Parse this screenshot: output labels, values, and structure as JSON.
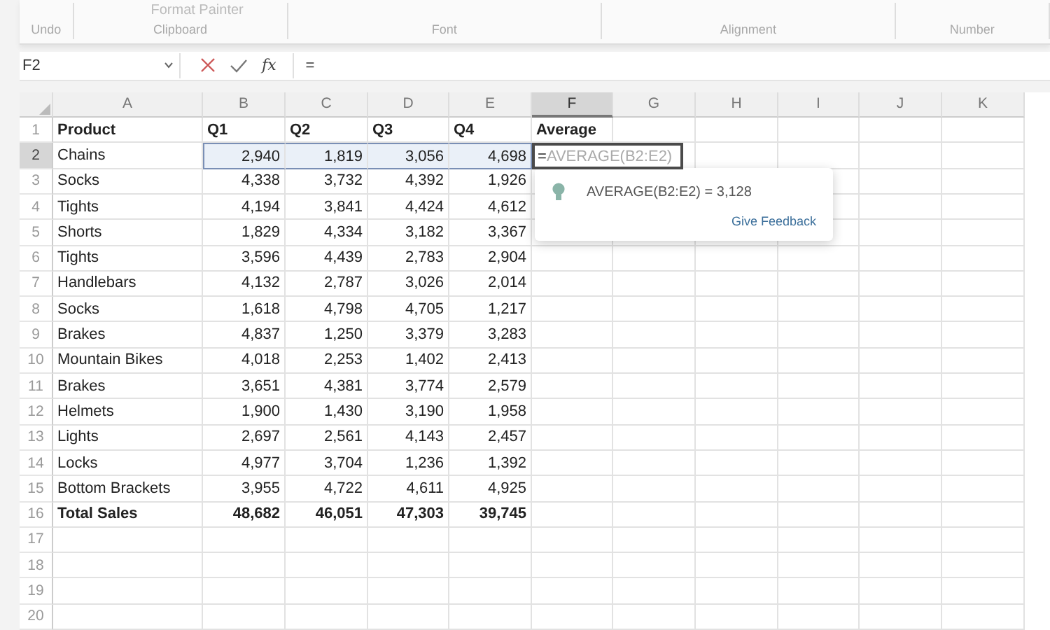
{
  "ribbon": {
    "groups": [
      {
        "label": "Undo"
      },
      {
        "label": "Clipboard",
        "command": "Format Painter"
      },
      {
        "label": "Font"
      },
      {
        "label": "Alignment"
      },
      {
        "label": "Number"
      }
    ]
  },
  "formula_bar": {
    "name_box": "F2",
    "function_label": "fx",
    "value": "="
  },
  "sheet": {
    "columns": [
      {
        "label": "A",
        "selected": false
      },
      {
        "label": "B",
        "selected": false
      },
      {
        "label": "C",
        "selected": false
      },
      {
        "label": "D",
        "selected": false
      },
      {
        "label": "E",
        "selected": false
      },
      {
        "label": "F",
        "selected": true
      },
      {
        "label": "G",
        "selected": false
      },
      {
        "label": "H",
        "selected": false
      },
      {
        "label": "I",
        "selected": false
      },
      {
        "label": "J",
        "selected": false
      },
      {
        "label": "K",
        "selected": false
      }
    ],
    "rows": [
      {
        "number": "1",
        "kind": "header",
        "selected": false,
        "highlighted": false,
        "cells": [
          "Product",
          "Q1",
          "Q2",
          "Q3",
          "Q4",
          "Average"
        ]
      },
      {
        "number": "2",
        "kind": "data",
        "selected": true,
        "highlighted": true,
        "cells": [
          "Chains",
          "2,940",
          "1,819",
          "3,056",
          "4,698"
        ],
        "editing": {
          "typed": "=",
          "suggestion": "AVERAGE(B2:E2)"
        }
      },
      {
        "number": "3",
        "kind": "data",
        "selected": false,
        "highlighted": false,
        "cells": [
          "Socks",
          "4,338",
          "3,732",
          "4,392",
          "1,926"
        ]
      },
      {
        "number": "4",
        "kind": "data",
        "selected": false,
        "highlighted": false,
        "cells": [
          "Tights",
          "4,194",
          "3,841",
          "4,424",
          "4,612"
        ]
      },
      {
        "number": "5",
        "kind": "data",
        "selected": false,
        "highlighted": false,
        "cells": [
          "Shorts",
          "1,829",
          "4,334",
          "3,182",
          "3,367"
        ]
      },
      {
        "number": "6",
        "kind": "data",
        "selected": false,
        "highlighted": false,
        "cells": [
          "Tights",
          "3,596",
          "4,439",
          "2,783",
          "2,904"
        ]
      },
      {
        "number": "7",
        "kind": "data",
        "selected": false,
        "highlighted": false,
        "cells": [
          "Handlebars",
          "4,132",
          "2,787",
          "3,026",
          "2,014"
        ]
      },
      {
        "number": "8",
        "kind": "data",
        "selected": false,
        "highlighted": false,
        "cells": [
          "Socks",
          "1,618",
          "4,798",
          "4,705",
          "1,217"
        ]
      },
      {
        "number": "9",
        "kind": "data",
        "selected": false,
        "highlighted": false,
        "cells": [
          "Brakes",
          "4,837",
          "1,250",
          "3,379",
          "3,283"
        ]
      },
      {
        "number": "10",
        "kind": "data",
        "selected": false,
        "highlighted": false,
        "cells": [
          "Mountain Bikes",
          "4,018",
          "2,253",
          "1,402",
          "2,413"
        ]
      },
      {
        "number": "11",
        "kind": "data",
        "selected": false,
        "highlighted": false,
        "cells": [
          "Brakes",
          "3,651",
          "4,381",
          "3,774",
          "2,579"
        ]
      },
      {
        "number": "12",
        "kind": "data",
        "selected": false,
        "highlighted": false,
        "cells": [
          "Helmets",
          "1,900",
          "1,430",
          "3,190",
          "1,958"
        ]
      },
      {
        "number": "13",
        "kind": "data",
        "selected": false,
        "highlighted": false,
        "cells": [
          "Lights",
          "2,697",
          "2,561",
          "4,143",
          "2,457"
        ]
      },
      {
        "number": "14",
        "kind": "data",
        "selected": false,
        "highlighted": false,
        "cells": [
          "Locks",
          "4,977",
          "3,704",
          "1,236",
          "1,392"
        ]
      },
      {
        "number": "15",
        "kind": "data",
        "selected": false,
        "highlighted": false,
        "cells": [
          "Bottom Brackets",
          "3,955",
          "4,722",
          "4,611",
          "4,925"
        ]
      },
      {
        "number": "16",
        "kind": "total",
        "selected": false,
        "highlighted": false,
        "cells": [
          "Total Sales",
          "48,682",
          "46,051",
          "47,303",
          "39,745"
        ]
      },
      {
        "number": "17",
        "kind": "empty",
        "selected": false,
        "highlighted": false,
        "cells": []
      },
      {
        "number": "18",
        "kind": "empty",
        "selected": false,
        "highlighted": false,
        "cells": []
      },
      {
        "number": "19",
        "kind": "empty",
        "selected": false,
        "highlighted": false,
        "cells": []
      },
      {
        "number": "20",
        "kind": "empty",
        "selected": false,
        "highlighted": false,
        "cells": []
      }
    ],
    "suggestion_tooltip": {
      "text": "AVERAGE(B2:E2) = 3,128",
      "link": "Give Feedback"
    }
  }
}
